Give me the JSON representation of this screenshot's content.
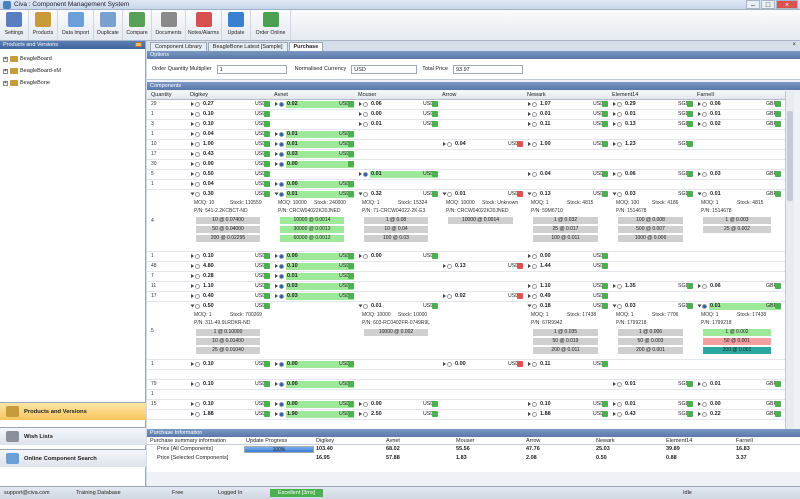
{
  "window": {
    "title": "Civa : Component Management System"
  },
  "toolbar": [
    {
      "label": "Settings",
      "icon": "settings-icon",
      "color": "#5a7fbf"
    },
    {
      "label": "Products",
      "icon": "products-icon",
      "color": "#c89a3a"
    },
    {
      "label": "Data Import",
      "icon": "data-import-icon",
      "color": "#6a9fd8"
    },
    {
      "label": "Duplicate",
      "icon": "duplicate-icon",
      "color": "#7aa0d0"
    },
    {
      "label": "Compare",
      "icon": "compare-icon",
      "color": "#58a058"
    },
    {
      "label": "Documents",
      "icon": "documents-icon",
      "color": "#8a8a8a"
    },
    {
      "label": "Notes/Alarms",
      "icon": "notes-alarms-icon",
      "color": "#d65050"
    },
    {
      "label": "Update",
      "icon": "update-icon",
      "color": "#3a80d0"
    },
    {
      "label": "Order Online",
      "icon": "order-online-icon",
      "color": "#4aa050"
    }
  ],
  "left": {
    "header": "Products and Versions",
    "tree": [
      "BeagleBoard",
      "BeagleBoard-xM",
      "BeagleBone"
    ],
    "nav": [
      "Products and Versions",
      "Wish Lists",
      "Online Component Search"
    ]
  },
  "tabs": [
    "Component Library",
    "BeagleBone Latest [Sample]",
    "Purchase"
  ],
  "options": {
    "section": "Options",
    "qty_label": "Order Quantity Multiplier",
    "qty_value": "1",
    "currency_label": "Normalised Currency",
    "currency_value": "USD",
    "total_label": "Total Price",
    "total_value": "93.97"
  },
  "components": {
    "section": "Components",
    "columns": [
      "Quantity",
      "Digikey",
      "Avnet",
      "Mouser",
      "Arrow",
      "Newark",
      "Element14",
      "Farnell"
    ],
    "quantities": [
      "29",
      "1",
      "3",
      "1",
      "10",
      "17",
      "30",
      "5",
      "1",
      "4",
      "1",
      "48",
      "7",
      "11",
      "17",
      "5",
      "1",
      "",
      "79",
      "1",
      "15"
    ],
    "rows": [
      [
        "0.27 USD",
        "0.02 USD",
        "0.06 USD",
        "",
        "1.07 USD",
        "0.29 SGD",
        "0.06 GBP"
      ],
      [
        "0.10 USD",
        "",
        "0.00 USD",
        "",
        "0.01 USD",
        "0.01 SGD",
        "0.01 GBP"
      ],
      [
        "0.10 USD",
        "",
        "0.01 USD",
        "",
        "0.11 USD",
        "0.13 SGD",
        "0.02 GBP"
      ],
      [
        "0.04 USD",
        "0.01 USD",
        "",
        "",
        "",
        "",
        ""
      ],
      [
        "1.00 USD",
        "0.01 USD",
        "",
        "0.04 USD",
        "1.00 USD",
        "1.23 SGD",
        ""
      ],
      [
        "0.43 USD",
        "0.03 USD",
        "",
        "",
        "",
        "",
        ""
      ],
      [
        "0.00 USD",
        "0.00",
        "",
        "",
        "",
        "",
        ""
      ],
      [
        "0.50 USD",
        "",
        "0.01 USD",
        "",
        "0.04 USD",
        "0.06 SGD",
        "0.03 GBP"
      ],
      [
        "0.04 USD",
        "0.00 USD",
        "",
        "",
        "",
        "",
        ""
      ]
    ],
    "expanded": {
      "digikey": {
        "price": "0.30 USD",
        "moq": "MOQ: 10",
        "stock": "Stock: 110559",
        "pn": "P/N: 541-2.2KCBCT-ND",
        "breaks": [
          "10 @ 0.07400",
          "50 @ 0.04000",
          "200 @ 0.02295"
        ]
      },
      "avnet": {
        "price": "0.01 USD",
        "moq": "MOQ: 10000",
        "stock": "Stock: 240000",
        "pn": "P/N: CRCW04022K20JNED",
        "breaks": [
          "10000 @ 0.0014",
          "30000 @ 0.0013",
          "60000 @ 0.0012"
        ]
      },
      "mouser": {
        "price": "0.32 USD",
        "moq": "MOQ: 1",
        "stock": "Stock: 15324",
        "pn": "P/N: 71-CRCW04022-2K-E3",
        "breaks": [
          "1 @ 0.08",
          "10 @ 0.04",
          "100 @ 0.03"
        ]
      },
      "arrow": {
        "price": "0.01 USD",
        "moq": "MOQ: 10000",
        "stock": "Stock: Unknown",
        "pn": "P/N: CRCW04022K20JNED",
        "breaks": [
          "10000 @ 0.0014"
        ]
      },
      "newark": {
        "price": "0.13 USD",
        "moq": "MOQ: 1",
        "stock": "Stock: 4815",
        "pn": "P/N: 59M6710",
        "breaks": [
          "1 @ 0.032",
          "25 @ 0.017",
          "100 @ 0.011"
        ]
      },
      "element14": {
        "price": "0.03 SGD",
        "moq": "MOQ: 100",
        "stock": "Stock: 4186",
        "pn": "P/N: 1514678",
        "breaks": [
          "100 @ 0.008",
          "500 @ 0.007",
          "1000 @ 0.006"
        ]
      },
      "farnell": {
        "price": "0.01 GBP",
        "moq": "MOQ: 1",
        "stock": "Stock: 4815",
        "pn": "P/N: 1514678",
        "breaks": [
          "1 @ 0.003",
          "25 @ 0.002"
        ]
      }
    },
    "rows2": [
      [
        "0.10 USD",
        "0.00 USD",
        "0.00 USD",
        "",
        "0.00 USD",
        "",
        ""
      ],
      [
        "4.80 USD",
        "0.10 USD",
        "",
        "0.13 USD",
        "1.44 USD",
        "",
        ""
      ],
      [
        "0.28 USD",
        "0.01 USD",
        "",
        "",
        "",
        "",
        ""
      ],
      [
        "1.10 USD",
        "0.03 USD",
        "",
        "",
        "1.10 USD",
        "1.35 SGD",
        "0.06 GBP"
      ],
      [
        "0.40 USD",
        "0.03 USD",
        "",
        "0.02 USD",
        "0.49 USD",
        "",
        ""
      ]
    ],
    "expanded2": {
      "digikey": {
        "price": "0.50 USD",
        "moq": "MOQ: 1",
        "stock": "Stock: 700269",
        "pn": "P/N: 311-49.9LRDKR-ND",
        "breaks": [
          "1 @ 0.10000",
          "10 @ 0.01400",
          "25 @ 0.01040"
        ]
      },
      "mouser": {
        "price": "0.01 USD",
        "moq": "MOQ: 10000",
        "stock": "Stock: 10000",
        "pn": "P/N: 603-RC0402FR-0749R9L",
        "breaks": [
          "10000 @ 0.002"
        ]
      },
      "newark": {
        "price": "0.18 USD",
        "moq": "MOQ: 1",
        "stock": "Stock: 17438",
        "pn": "P/N: 67R9942",
        "breaks": [
          "1 @ 0.035",
          "50 @ 0.019",
          "200 @ 0.011"
        ]
      },
      "element14": {
        "price": "0.03 SGD",
        "moq": "MOQ: 1",
        "stock": "Stock: 7706",
        "pn": "P/N: 1799218",
        "breaks": [
          "1 @ 0.006",
          "50 @ 0.003",
          "200 @ 0.001"
        ]
      },
      "farnell": {
        "price": "0.01 GBP",
        "moq": "MOQ: 1",
        "stock": "Stock: 17438",
        "pn": "P/N: 1799218",
        "breaks": [
          "1 @ 0.002",
          "50 @ 0.001",
          "200 @ 0.001"
        ]
      }
    },
    "rows3": [
      [
        "0.10 USD",
        "0.00 USD",
        "",
        "0.00 USD",
        "0.11 USD",
        "",
        ""
      ],
      [
        "",
        "",
        "",
        "",
        "",
        "",
        ""
      ],
      [
        "0.10 USD",
        "0.00 USD",
        "",
        "",
        "",
        "0.01 SGD",
        "0.01 GBP"
      ],
      [
        "",
        "",
        "",
        "",
        "",
        "",
        ""
      ],
      [
        "0.10 USD",
        "0.00 USD",
        "0.00 USD",
        "",
        "0.10 USD",
        "0.01 SGD",
        "0.00 GBP"
      ],
      [
        "1.88 USD",
        "1.90 USD",
        "2.50 USD",
        "",
        "1.88 USD",
        "0.43 SGD",
        "0.22 GBP"
      ]
    ]
  },
  "purchase": {
    "section": "Purchase Information",
    "headers": [
      "Purchase summary information",
      "Update Progress",
      "Digikey",
      "Avnet",
      "Mouser",
      "Arrow",
      "Newark",
      "Element14",
      "Farnell"
    ],
    "progress": "100%",
    "progress_value": 1.0,
    "all": {
      "label": "Price [All Components]",
      "values": [
        "103.40",
        "68.02",
        "55.56",
        "47.76",
        "25.03",
        "39.89",
        "16.83"
      ]
    },
    "selected": {
      "label": "Price [Selected Components]",
      "values": [
        "16.95",
        "57.88",
        "1.83",
        "2.08",
        "0.50",
        "0.88",
        "3.37"
      ]
    }
  },
  "status": {
    "email": "support@civa.com",
    "db": "Training Database",
    "free": "Free",
    "login": "Logged In",
    "conn": "Excellent [3ms]",
    "idle": "Idle"
  }
}
